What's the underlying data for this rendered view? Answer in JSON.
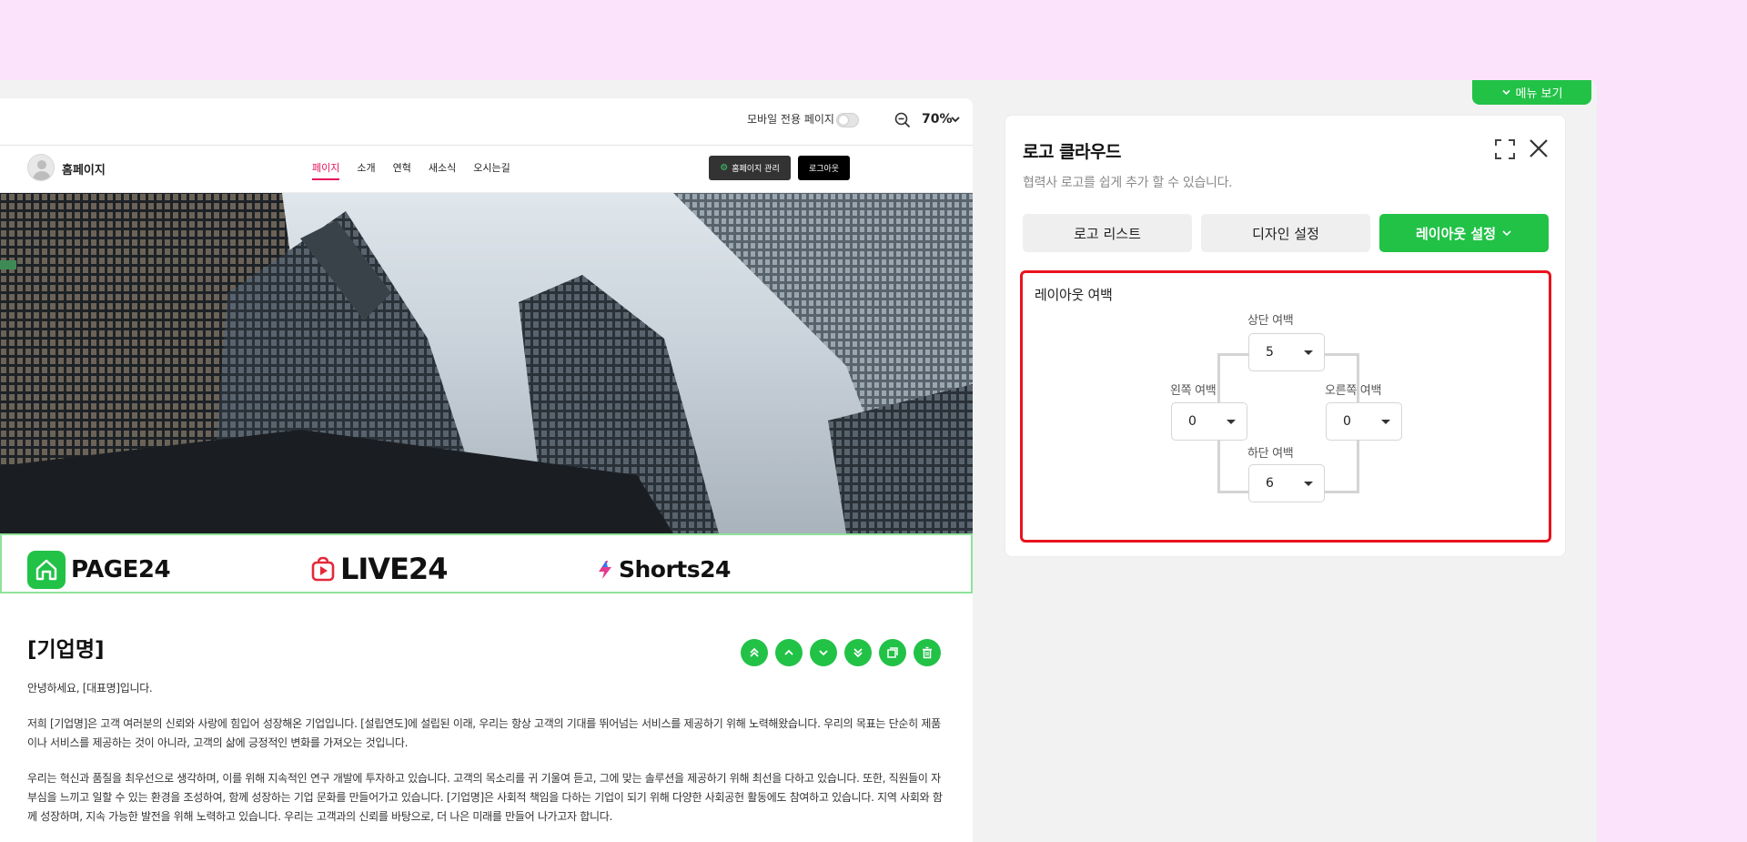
{
  "preview": {
    "mobile_label": "모바일 전용 페이지",
    "zoom": "70%",
    "site": {
      "name": "홈페이지",
      "nav": [
        "페이지",
        "소개",
        "연혁",
        "새소식",
        "오시는길"
      ],
      "active_nav": "페이지",
      "manage_label": "홈페이지 관리",
      "logout_label": "로그아웃"
    },
    "logos": [
      "PAGE24",
      "LIVE24",
      "Shorts24"
    ],
    "article": {
      "title": "[기업명]",
      "greeting": "안녕하세요, [대표명]입니다.",
      "para1": "저희 [기업명]은 고객 여러분의 신뢰와 사랑에 힘입어 성장해온 기업입니다. [설립연도]에 설립된 이래, 우리는 항상 고객의 기대를 뛰어넘는 서비스를 제공하기 위해 노력해왔습니다. 우리의 목표는 단순히 제품이나 서비스를 제공하는 것이 아니라, 고객의 삶에 긍정적인 변화를 가져오는 것입니다.",
      "para2": "우리는 혁신과 품질을 최우선으로 생각하며, 이를 위해 지속적인 연구 개발에 투자하고 있습니다. 고객의 목소리를 귀 기울여 듣고, 그에 맞는 솔루션을 제공하기 위해 최선을 다하고 있습니다. 또한, 직원들이 자부심을 느끼고 일할 수 있는 환경을 조성하여, 함께 성장하는 기업 문화를 만들어가고 있습니다. [기업명]은 사회적 책임을 다하는 기업이 되기 위해 다양한 사회공헌 활동에도 참여하고 있습니다. 지역 사회와 함께 성장하며, 지속 가능한 발전을 위해 노력하고 있습니다. 우리는 고객과의 신뢰를 바탕으로, 더 나은 미래를 만들어 나가고자 합니다."
    }
  },
  "panel": {
    "menu_tab": "메뉴 보기",
    "title": "로고 클라우드",
    "subtitle": "협력사 로고를 쉽게 추가 할 수 있습니다.",
    "tabs": [
      "로고 리스트",
      "디자인 설정",
      "레이아웃 설정"
    ],
    "active_tab": "레이아웃 설정",
    "layout": {
      "label": "레이아웃 여백",
      "top_label": "상단 여백",
      "top_value": "5",
      "left_label": "왼쪽 여백",
      "left_value": "0",
      "right_label": "오른쪽 여백",
      "right_value": "0",
      "bottom_label": "하단 여백",
      "bottom_value": "6"
    }
  },
  "colors": {
    "accent_green": "#22c247",
    "highlight_red": "#e8131e",
    "nav_active": "#e5135c",
    "background_pink": "#fbe4fb"
  }
}
